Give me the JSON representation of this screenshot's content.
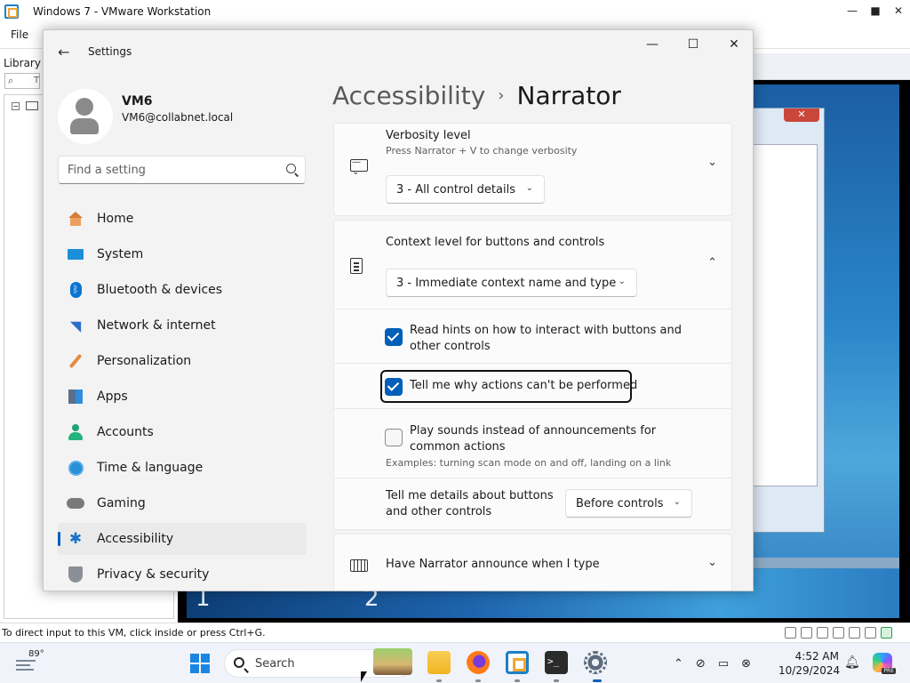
{
  "vmware": {
    "window_title": "Windows 7 - VMware Workstation",
    "menu_file": "File",
    "library_label": "Library",
    "search_placeholder_fragment": "T",
    "status_text": "To direct input to this VM, click inside or press Ctrl+G.",
    "desktop_num_1": "1",
    "desktop_num_2": "2",
    "w7_close": "✕"
  },
  "settings": {
    "title": "Settings",
    "user": {
      "name": "VM6",
      "email": "VM6@collabnet.local"
    },
    "search_placeholder": "Find a setting",
    "nav": [
      {
        "label": "Home",
        "icon": "home-icon"
      },
      {
        "label": "System",
        "icon": "system-icon"
      },
      {
        "label": "Bluetooth & devices",
        "icon": "bluetooth-icon"
      },
      {
        "label": "Network & internet",
        "icon": "wifi-icon"
      },
      {
        "label": "Personalization",
        "icon": "brush-icon"
      },
      {
        "label": "Apps",
        "icon": "apps-icon"
      },
      {
        "label": "Accounts",
        "icon": "person-icon"
      },
      {
        "label": "Time & language",
        "icon": "clock-globe-icon"
      },
      {
        "label": "Gaming",
        "icon": "gamepad-icon"
      },
      {
        "label": "Accessibility",
        "icon": "accessibility-icon",
        "active": true
      },
      {
        "label": "Privacy & security",
        "icon": "shield-icon"
      }
    ],
    "breadcrumb": {
      "parent": "Accessibility",
      "separator": "›",
      "current": "Narrator"
    },
    "verbosity": {
      "title": "Verbosity level",
      "subtitle": "Press Narrator + V to change verbosity",
      "value": "3 - All control details"
    },
    "context": {
      "title": "Context level for buttons and controls",
      "value": "3 - Immediate context name and type"
    },
    "options": {
      "read_hints": {
        "label_line1": "Read hints on how to interact with buttons and",
        "label_line2": "other controls",
        "checked": true
      },
      "tell_why": {
        "label": "Tell me why actions can't be performed",
        "checked": true
      },
      "play_sounds": {
        "label_line1": "Play sounds instead of announcements for",
        "label_line2": "common actions",
        "hint": "Examples: turning scan mode on and off, landing on a link",
        "checked": false
      }
    },
    "details": {
      "label_line1": "Tell me details about buttons",
      "label_line2": "and other controls",
      "value": "Before controls"
    },
    "typing": {
      "title": "Have Narrator announce when I type"
    },
    "window_buttons": {
      "minimize": "—",
      "maximize": "☐",
      "close": "✕"
    }
  },
  "taskbar": {
    "weather_temp": "89°",
    "search_text": "Search",
    "time": "4:52 AM",
    "date": "10/29/2024",
    "copilot_badge": "PRE"
  },
  "colors": {
    "accent": "#005fb8",
    "taskbar": "#f0f3f9",
    "settings_bg": "#f3f3f3"
  }
}
